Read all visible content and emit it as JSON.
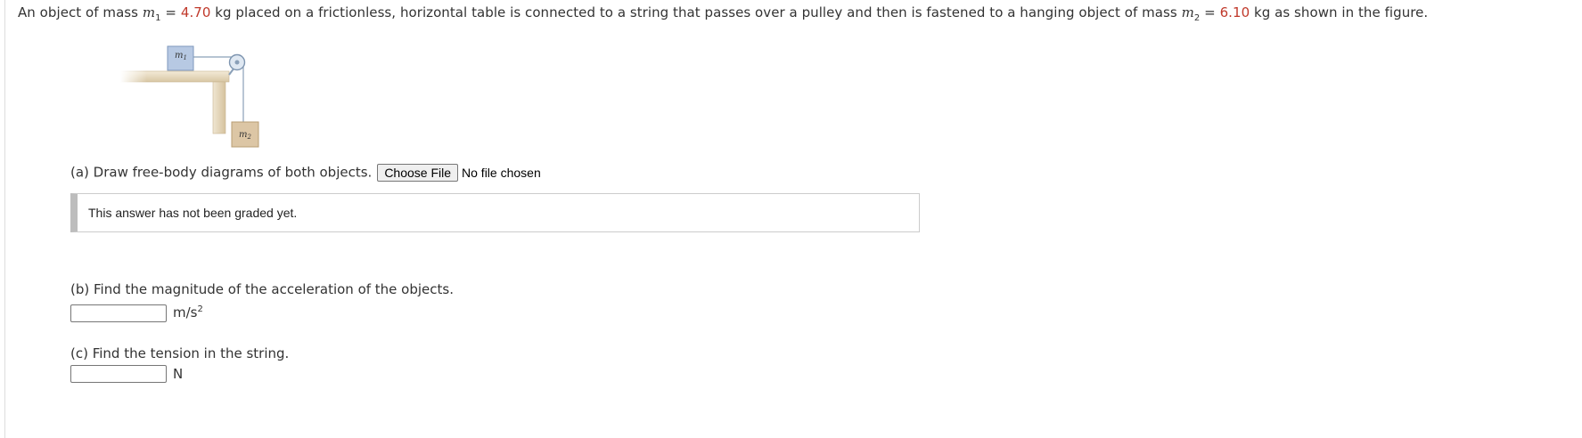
{
  "problem": {
    "intro": "An object of mass",
    "m1_symbol": "m",
    "m1_sub": "1",
    "eq": "=",
    "m1_value": "4.70",
    "mid": "kg placed on a frictionless, horizontal table is connected to a string that passes over a pulley and then is fastened to a hanging object of mass",
    "m2_symbol": "m",
    "m2_sub": "2",
    "m2_value": "6.10",
    "end": "kg as shown in the figure."
  },
  "figure": {
    "m1_label": "m",
    "m1_sub": "1",
    "m2_label": "m",
    "m2_sub": "2",
    "colors": {
      "block1": "#b7c9e3",
      "block2": "#dcc6a5",
      "table": "#e9dcc2",
      "string": "#8aa0b8"
    }
  },
  "part_a": {
    "text": "(a) Draw free-body diagrams of both objects.",
    "file_button": "Choose File",
    "file_status": "No file chosen",
    "graded_text": "This answer has not been graded yet."
  },
  "part_b": {
    "text": "(b) Find the magnitude of the acceleration of the objects.",
    "input_value": "",
    "unit": "m/s",
    "unit_sup": "2"
  },
  "part_c": {
    "text": "(c) Find the tension in the string.",
    "input_value": "",
    "unit": "N"
  }
}
